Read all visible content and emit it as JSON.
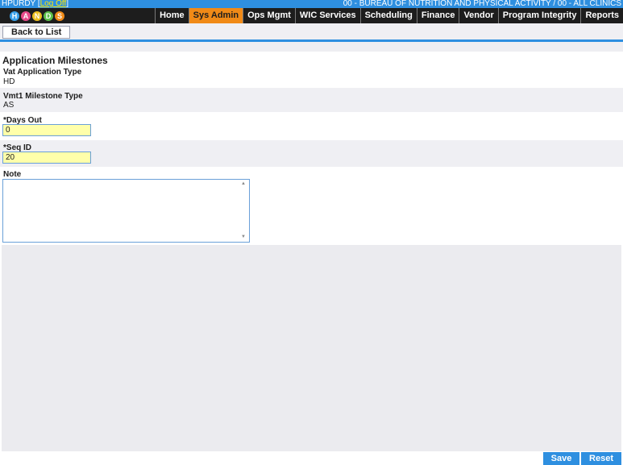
{
  "topbar": {
    "user": "HPURDY",
    "bracket_open": " [",
    "logoff": "Log Off",
    "bracket_close": "]",
    "org": "00 - BUREAU OF NUTRITION AND PHYSICAL ACTIVITY / 00 - ALL CLINICS"
  },
  "logo": {
    "text": "HANDS"
  },
  "nav": {
    "items": [
      "Home",
      "Sys Admin",
      "Ops Mgmt",
      "WIC Services",
      "Scheduling",
      "Finance",
      "Vendor",
      "Program Integrity",
      "Reports"
    ],
    "active": "Sys Admin"
  },
  "toolbar": {
    "back_label": "Back to List"
  },
  "form": {
    "title": "Application Milestones",
    "vat_label": "Vat Application Type",
    "vat_value": "HD",
    "vmt_label": "Vmt1 Milestone Type",
    "vmt_value": "AS",
    "req_marker": "*",
    "days_label": "Days Out",
    "days_value": "0",
    "seq_label": "Seq ID",
    "seq_value": "20",
    "note_label": "Note",
    "note_value": ""
  },
  "actions": {
    "save_label": "Save",
    "reset_label": "Reset"
  },
  "colors": {
    "accent": "#2e8fe0",
    "active_tab": "#f08a17",
    "nav_bg": "#1d1d1d",
    "required_field": "#ffffaa"
  }
}
